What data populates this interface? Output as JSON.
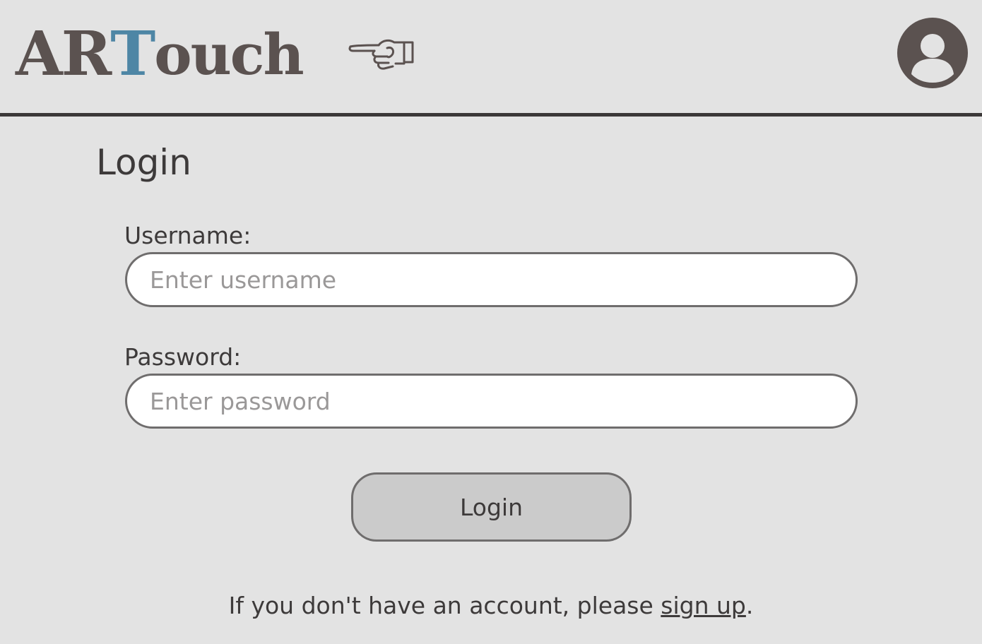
{
  "header": {
    "logo": {
      "part1": "AR",
      "part2": "T",
      "part3": "ouch"
    },
    "logo_icon": "pointing-hand-icon",
    "avatar_icon": "user-avatar-icon"
  },
  "colors": {
    "background": "#e3e3e3",
    "brand_dark": "#5b5250",
    "brand_accent": "#4e86a5",
    "input_border": "#6f6d6d",
    "button_fill": "#cbcbcb"
  },
  "main": {
    "title": "Login",
    "username": {
      "label": "Username:",
      "placeholder": "Enter username",
      "value": ""
    },
    "password": {
      "label": "Password:",
      "placeholder": "Enter password",
      "value": ""
    },
    "login_button": "Login",
    "signup": {
      "prefix": "If you don't have an account, please ",
      "link": "sign up",
      "suffix": "."
    }
  }
}
